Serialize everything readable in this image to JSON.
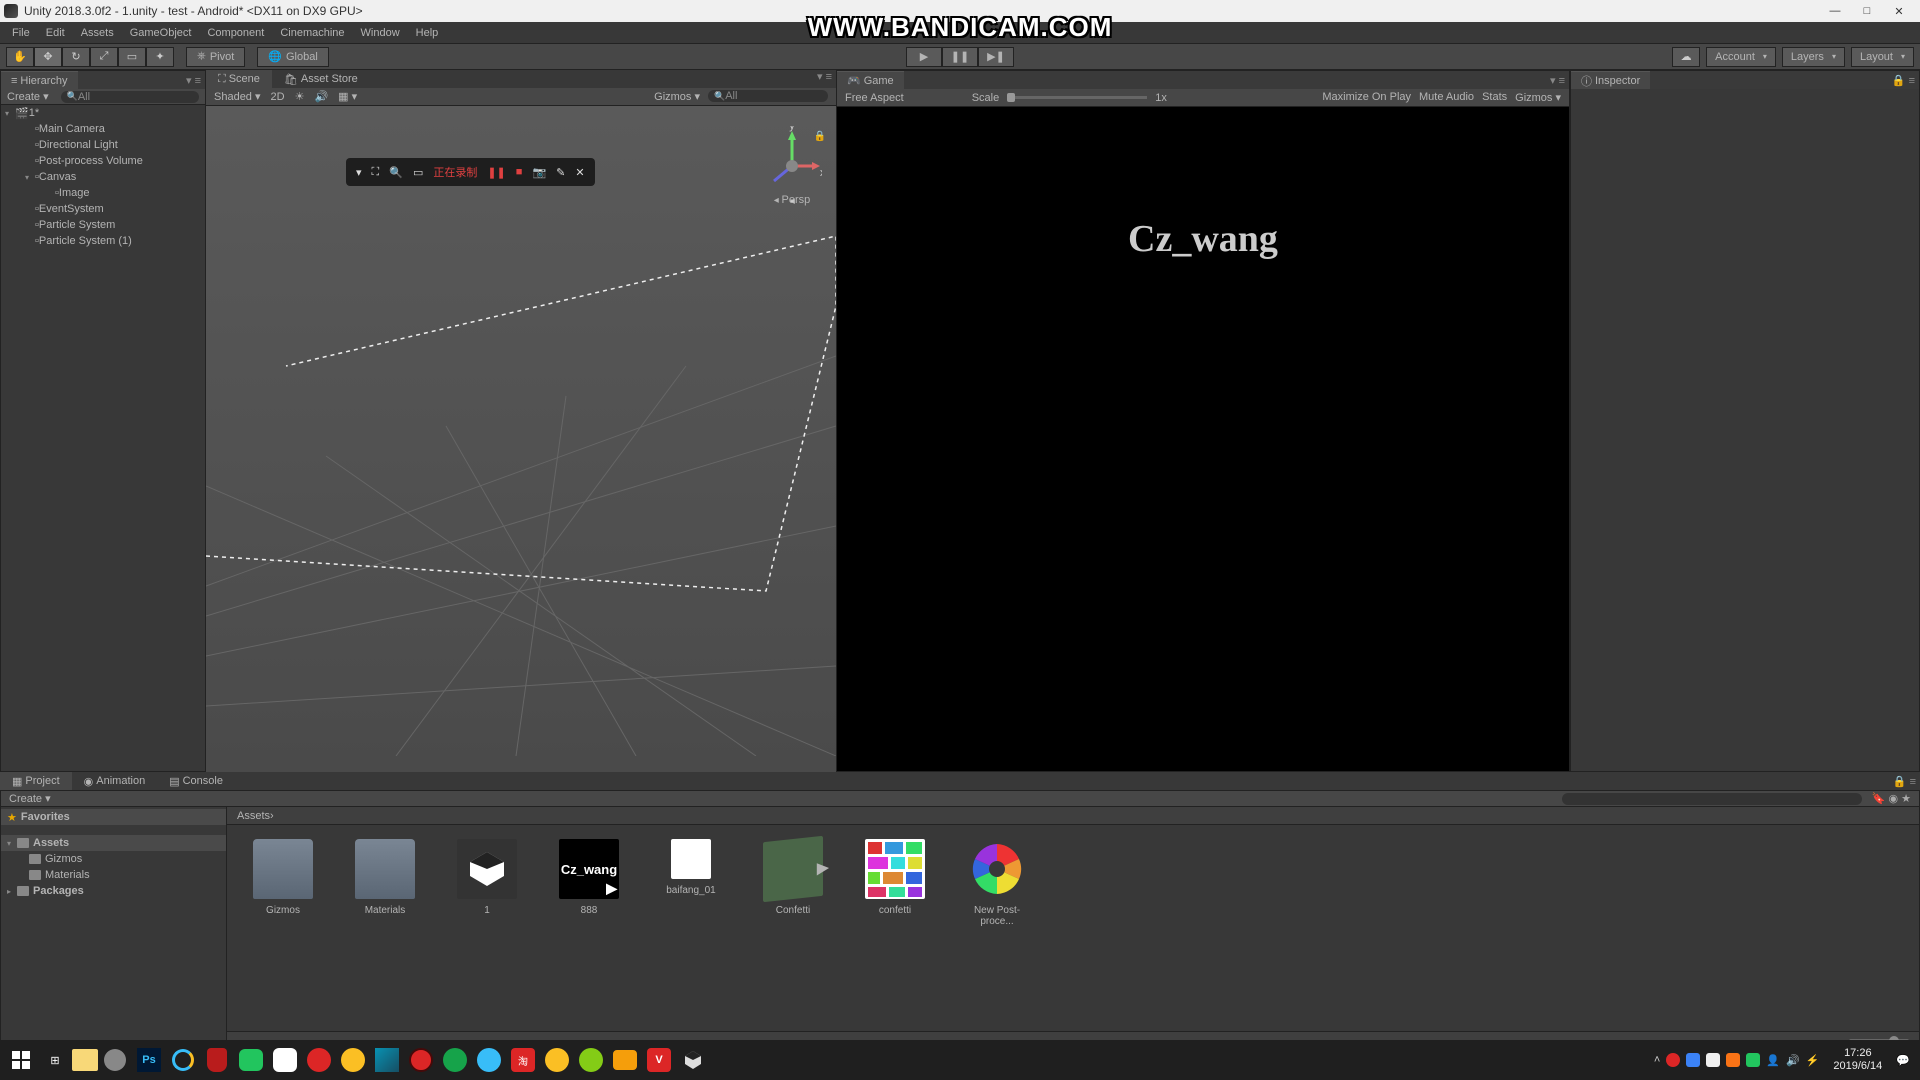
{
  "titlebar": {
    "text": "Unity 2018.3.0f2 - 1.unity - test - Android* <DX11 on DX9 GPU>"
  },
  "menubar": [
    "File",
    "Edit",
    "Assets",
    "GameObject",
    "Component",
    "Cinemachine",
    "Window",
    "Help"
  ],
  "watermark": "WWW.BANDICAM.COM",
  "toolbar": {
    "pivot": "Pivot",
    "global": "Global",
    "account": "Account",
    "layers": "Layers",
    "layout": "Layout"
  },
  "hierarchy": {
    "title": "Hierarchy",
    "create": "Create",
    "search_placeholder": "All",
    "scene_name": "1*",
    "items": [
      {
        "name": "Main Camera",
        "indent": 1
      },
      {
        "name": "Directional Light",
        "indent": 1
      },
      {
        "name": "Post-process Volume",
        "indent": 1
      },
      {
        "name": "Canvas",
        "indent": 1,
        "expandable": true
      },
      {
        "name": "Image",
        "indent": 2
      },
      {
        "name": "EventSystem",
        "indent": 1
      },
      {
        "name": "Particle System",
        "indent": 1
      },
      {
        "name": "Particle System (1)",
        "indent": 1
      }
    ]
  },
  "scene": {
    "tab_scene": "Scene",
    "tab_asset_store": "Asset Store",
    "shaded": "Shaded",
    "view_2d": "2D",
    "gizmos": "Gizmos",
    "search": "All",
    "persp": "Persp",
    "axes": {
      "x": "x",
      "y": "y"
    },
    "recording": {
      "label": "正在录制"
    }
  },
  "game": {
    "tab": "Game",
    "free_aspect": "Free Aspect",
    "scale": "Scale",
    "scale_value": "1x",
    "maximize": "Maximize On Play",
    "mute": "Mute Audio",
    "stats": "Stats",
    "gizmos": "Gizmos",
    "overlay_text": "Cz_wang"
  },
  "inspector": {
    "title": "Inspector"
  },
  "project": {
    "tabs": {
      "project": "Project",
      "animation": "Animation",
      "console": "Console"
    },
    "create": "Create",
    "favorites": "Favorites",
    "assets": "Assets",
    "folders": [
      "Gizmos",
      "Materials"
    ],
    "packages": "Packages",
    "breadcrumb": "Assets",
    "items": [
      {
        "name": "Gizmos",
        "type": "folder"
      },
      {
        "name": "Materials",
        "type": "folder"
      },
      {
        "name": "1",
        "type": "scene"
      },
      {
        "name": "888",
        "type": "image_text"
      },
      {
        "name": "baifang_01",
        "type": "white"
      },
      {
        "name": "Confetti",
        "type": "prefab"
      },
      {
        "name": "confetti",
        "type": "colorgrid"
      },
      {
        "name": "New Post-proce...",
        "type": "shutter"
      }
    ]
  },
  "taskbar": {
    "time": "17:26",
    "date": "2019/6/14"
  }
}
